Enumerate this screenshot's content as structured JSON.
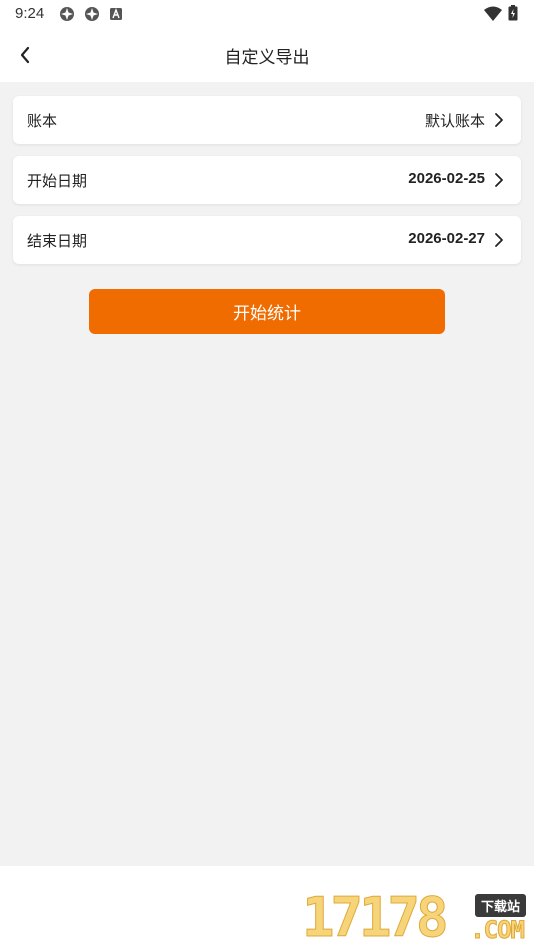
{
  "status_bar": {
    "time": "9:24"
  },
  "header": {
    "title": "自定义导出"
  },
  "rows": [
    {
      "label": "账本",
      "value": "默认账本"
    },
    {
      "label": "开始日期",
      "value": "2026-02-25"
    },
    {
      "label": "结束日期",
      "value": "2026-02-27"
    }
  ],
  "action": {
    "start_label": "开始统计"
  },
  "watermark": {
    "digits": "17178",
    "badge": "下载站",
    "com": ".COM"
  },
  "colors": {
    "accent": "#f06c00",
    "background": "#f2f2f2"
  }
}
